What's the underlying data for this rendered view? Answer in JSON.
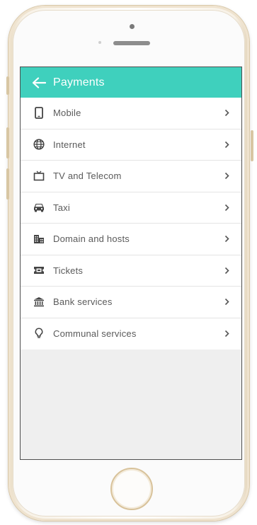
{
  "appbar": {
    "title": "Payments",
    "back_icon": "arrow-left-icon",
    "color": "#3fd0bd"
  },
  "menu": [
    {
      "label": "Mobile",
      "icon": "smartphone-icon"
    },
    {
      "label": "Internet",
      "icon": "globe-icon"
    },
    {
      "label": "TV and Telecom",
      "icon": "tv-icon"
    },
    {
      "label": "Taxi",
      "icon": "car-icon"
    },
    {
      "label": "Domain and hosts",
      "icon": "building-icon"
    },
    {
      "label": "Tickets",
      "icon": "ticket-icon"
    },
    {
      "label": "Bank services",
      "icon": "bank-icon"
    },
    {
      "label": "Communal services",
      "icon": "lightbulb-icon"
    }
  ]
}
